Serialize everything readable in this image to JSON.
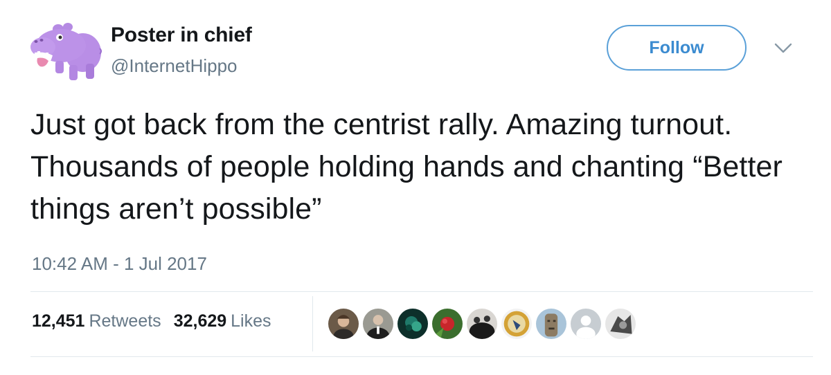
{
  "user": {
    "display_name": "Poster in chief",
    "handle": "@InternetHippo",
    "avatar_icon": "purple-hippo-avatar"
  },
  "actions": {
    "follow_label": "Follow",
    "more_icon": "chevron-down-icon"
  },
  "tweet": {
    "text": "Just got back from the centrist rally. Amazing turnout. Thousands of people holding hands and chanting “Better things aren’t possible”",
    "timestamp": "10:42 AM - 1 Jul 2017"
  },
  "stats": {
    "retweets_count": "12,451",
    "retweets_label": "Retweets",
    "likes_count": "32,629",
    "likes_label": "Likes"
  },
  "liker_avatars": [
    "liker-avatar-1",
    "liker-avatar-2",
    "liker-avatar-3",
    "liker-avatar-4",
    "liker-avatar-5",
    "liker-avatar-6",
    "liker-avatar-7",
    "liker-avatar-8",
    "liker-avatar-9"
  ],
  "colors": {
    "accent": "#3b8bd0",
    "text": "#14171a",
    "muted": "#657786",
    "avatar": "#b98ee6"
  }
}
